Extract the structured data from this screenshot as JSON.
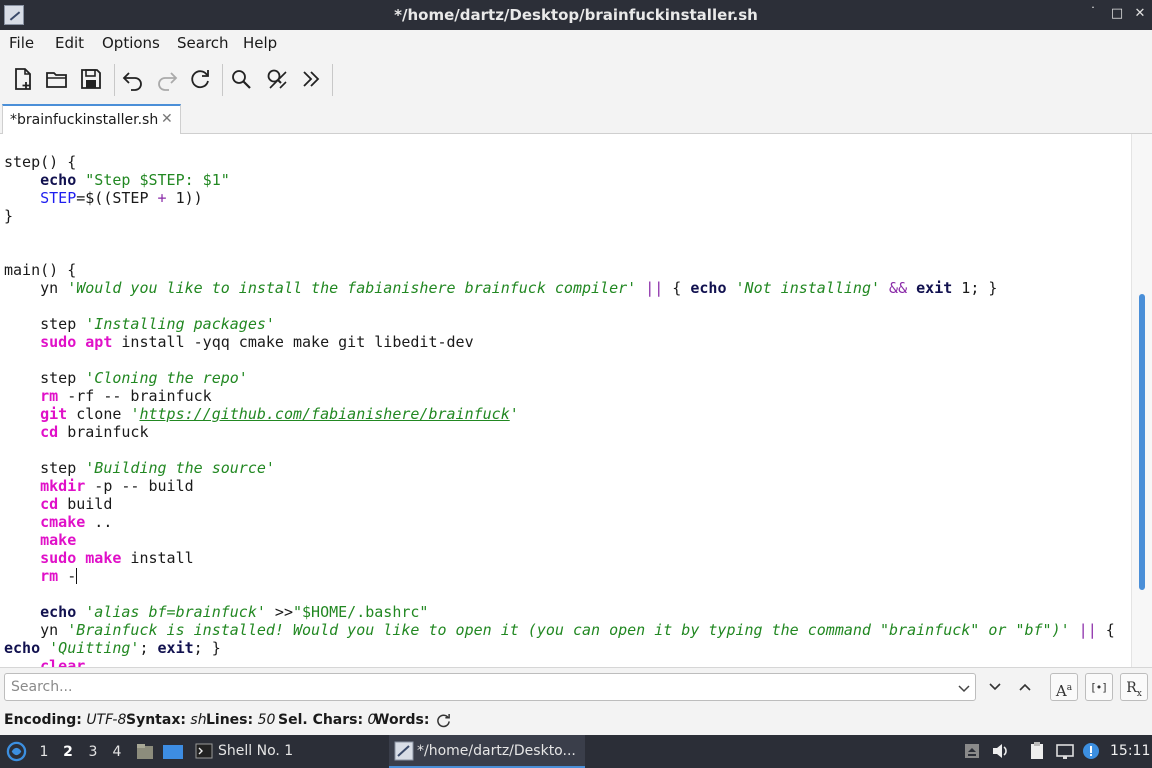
{
  "window": {
    "title": "*/home/dartz/Desktop/brainfuckinstaller.sh",
    "minimize": "˙",
    "maximize": "□",
    "close": "✕"
  },
  "menu": {
    "file": "File",
    "edit": "Edit",
    "options": "Options",
    "search": "Search",
    "help": "Help"
  },
  "toolbar": {
    "icons": [
      "new-document-icon",
      "open-folder-icon",
      "save-icon",
      "undo-icon",
      "redo-icon",
      "reload-icon",
      "find-icon",
      "find-replace-icon",
      "more-icon"
    ]
  },
  "tab": {
    "label": "*brainfuckinstaller.sh",
    "close": "✕"
  },
  "editor": {
    "lines": [
      [
        [
          "t",
          "step() {"
        ]
      ],
      [
        [
          "t",
          "    "
        ],
        [
          "kw",
          "echo"
        ],
        [
          "t",
          " "
        ],
        [
          "dq",
          "\"Step $STEP: $1\""
        ]
      ],
      [
        [
          "t",
          "    "
        ],
        [
          "var",
          "STEP"
        ],
        [
          "t",
          "=$((STEP "
        ],
        [
          "op",
          "+"
        ],
        [
          "t",
          " 1))"
        ]
      ],
      [
        [
          "t",
          "}"
        ]
      ],
      [],
      [],
      [
        [
          "t",
          "main() {"
        ]
      ],
      [
        [
          "t",
          "    yn "
        ],
        [
          "sq",
          "'Would you like to install the fabianishere brainfuck compiler'"
        ],
        [
          "t",
          " "
        ],
        [
          "op",
          "||"
        ],
        [
          "t",
          " { "
        ],
        [
          "kw",
          "echo"
        ],
        [
          "t",
          " "
        ],
        [
          "sq",
          "'Not installing'"
        ],
        [
          "t",
          " "
        ],
        [
          "op",
          "&&"
        ],
        [
          "t",
          " "
        ],
        [
          "kw",
          "exit"
        ],
        [
          "t",
          " 1; }"
        ]
      ],
      [],
      [
        [
          "t",
          "    step "
        ],
        [
          "sq",
          "'Installing packages'"
        ]
      ],
      [
        [
          "t",
          "    "
        ],
        [
          "cmd",
          "sudo"
        ],
        [
          "t",
          " "
        ],
        [
          "cmd",
          "apt"
        ],
        [
          "t",
          " install -yqq cmake make git libedit-dev"
        ]
      ],
      [],
      [
        [
          "t",
          "    step "
        ],
        [
          "sq",
          "'Cloning the repo'"
        ]
      ],
      [
        [
          "t",
          "    "
        ],
        [
          "cmd",
          "rm"
        ],
        [
          "t",
          " -rf -- brainfuck"
        ]
      ],
      [
        [
          "t",
          "    "
        ],
        [
          "cmd",
          "git"
        ],
        [
          "t",
          " clone "
        ],
        [
          "sq",
          "'"
        ],
        [
          "url",
          "https://github.com/fabianishere/brainfuck"
        ],
        [
          "sq",
          "'"
        ]
      ],
      [
        [
          "t",
          "    "
        ],
        [
          "cmd",
          "cd"
        ],
        [
          "t",
          " brainfuck"
        ]
      ],
      [],
      [
        [
          "t",
          "    step "
        ],
        [
          "sq",
          "'Building the source'"
        ]
      ],
      [
        [
          "t",
          "    "
        ],
        [
          "cmd",
          "mkdir"
        ],
        [
          "t",
          " -p -- build"
        ]
      ],
      [
        [
          "t",
          "    "
        ],
        [
          "cmd",
          "cd"
        ],
        [
          "t",
          " build"
        ]
      ],
      [
        [
          "t",
          "    "
        ],
        [
          "cmd",
          "cmake"
        ],
        [
          "t",
          " .."
        ]
      ],
      [
        [
          "t",
          "    "
        ],
        [
          "cmd",
          "make"
        ]
      ],
      [
        [
          "t",
          "    "
        ],
        [
          "cmd",
          "sudo"
        ],
        [
          "t",
          " "
        ],
        [
          "cmd",
          "make"
        ],
        [
          "t",
          " install"
        ]
      ],
      [
        [
          "t",
          "    "
        ],
        [
          "cmd",
          "rm"
        ],
        [
          "t",
          " -"
        ],
        [
          "caret",
          ""
        ]
      ],
      [],
      [
        [
          "t",
          "    "
        ],
        [
          "kw",
          "echo"
        ],
        [
          "t",
          " "
        ],
        [
          "sq",
          "'alias bf=brainfuck'"
        ],
        [
          "t",
          " >>"
        ],
        [
          "dq",
          "\"$HOME/.bashrc\""
        ]
      ],
      [
        [
          "t",
          "    yn "
        ],
        [
          "sq",
          "'Brainfuck is installed! Would you like to open it (you can open it by typing the command \"brainfuck\" or \"bf\")'"
        ],
        [
          "t",
          " "
        ],
        [
          "op",
          "||"
        ],
        [
          "t",
          " {"
        ]
      ],
      [
        [
          "kw",
          "echo"
        ],
        [
          "t",
          " "
        ],
        [
          "sq",
          "'Quitting'"
        ],
        [
          "t",
          "; "
        ],
        [
          "kw",
          "exit"
        ],
        [
          "t",
          "; }"
        ]
      ],
      [
        [
          "t",
          "    "
        ],
        [
          "cmd",
          "clear"
        ]
      ]
    ]
  },
  "search": {
    "placeholder": "Search...",
    "value": ""
  },
  "status": {
    "encoding_label": "Encoding:",
    "encoding": "UTF-8",
    "syntax_label": "Syntax:",
    "syntax": "sh",
    "lines_label": "Lines:",
    "lines": "50",
    "selchars_label": "Sel. Chars:",
    "selchars": "0",
    "words_label": "Words:"
  },
  "taskbar": {
    "workspaces": [
      "1",
      "2",
      "3",
      "4"
    ],
    "active_workspace": "2",
    "tasks": [
      {
        "label": "Shell No. 1"
      },
      {
        "label": "*/home/dartz/Deskto..."
      }
    ],
    "clock": "15:11"
  }
}
